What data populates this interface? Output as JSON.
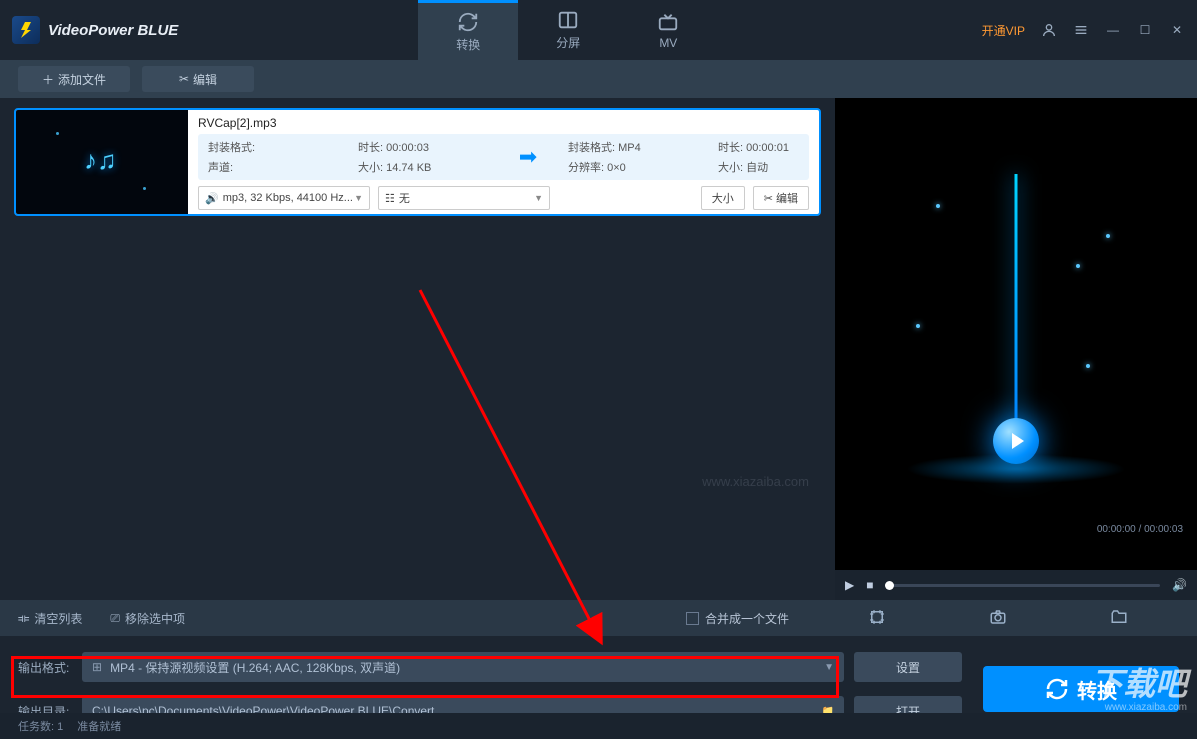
{
  "app": {
    "title": "VideoPower BLUE"
  },
  "tabs": {
    "convert": "转换",
    "split": "分屏",
    "mv": "MV"
  },
  "win": {
    "vip": "开通VIP"
  },
  "toolbar": {
    "add": "添加文件",
    "edit": "编辑"
  },
  "file": {
    "name": "RVCap[2].mp3",
    "src": {
      "container_label": "封装格式:",
      "container": "",
      "channel_label": "声道:",
      "channel": "",
      "duration_label": "时长:",
      "duration": "00:00:03",
      "size_label": "大小:",
      "size": "14.74 KB"
    },
    "dst": {
      "container_label": "封装格式:",
      "container": "MP4",
      "res_label": "分辨率:",
      "res": "0×0",
      "duration_label": "时长:",
      "duration": "00:00:01",
      "size_label": "大小:",
      "size": "自动"
    },
    "format_dd": "mp3, 32 Kbps, 44100 Hz...",
    "subtitle_dd": "无",
    "size_btn": "大小",
    "edit_btn": "编辑"
  },
  "player": {
    "time": "00:00:00 / 00:00:03"
  },
  "midbar": {
    "clear": "清空列表",
    "remove": "移除选中项",
    "merge": "合并成一个文件"
  },
  "output": {
    "format_label": "输出格式:",
    "format_value": "MP4 - 保持源视频设置 (H.264; AAC, 128Kbps, 双声道)",
    "dir_label": "输出目录:",
    "dir_value": "C:\\Users\\pc\\Documents\\VideoPower\\VideoPower BLUE\\Convert",
    "settings_btn": "设置",
    "open_btn": "打开",
    "convert_btn": "转换"
  },
  "status": {
    "tasks_label": "任务数:",
    "tasks": "1",
    "ready": "准备就绪"
  },
  "watermark": {
    "main": "下载吧",
    "url": "www.xiazaiba.com"
  }
}
